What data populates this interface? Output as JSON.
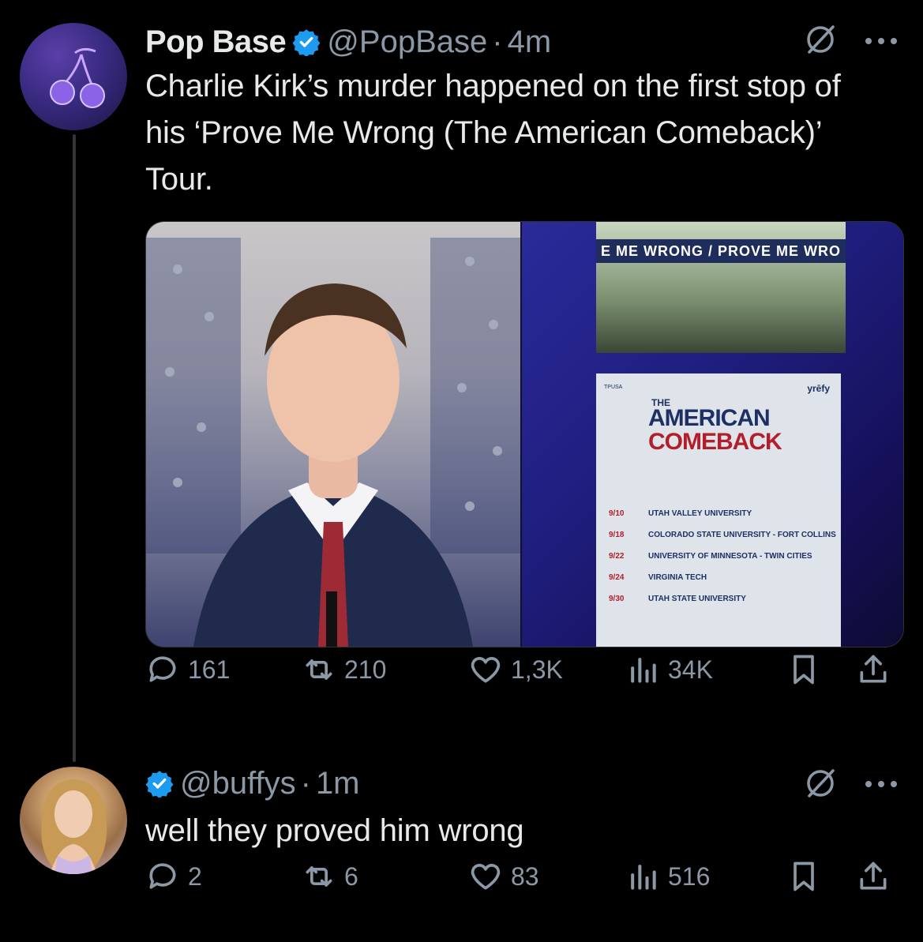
{
  "tweet1": {
    "name": "Pop Base",
    "handle": "@PopBase",
    "separator": "·",
    "time": "4m",
    "text": "Charlie Kirk’s murder happened on the first stop of his ‘Prove Me Wrong (The American Comeback)’ Tour.",
    "media": {
      "banner_text": "E ME WRONG / PROVE ME WRO",
      "flyer_brand": "yrēfy",
      "flyer_title_the": "THE",
      "flyer_title_american": "AMERICAN",
      "flyer_title_comeback": "COMEBACK",
      "schedule": [
        {
          "date": "9/10",
          "event": "UTAH VALLEY UNIVERSITY"
        },
        {
          "date": "9/18",
          "event": "COLORADO STATE UNIVERSITY - FORT COLLINS"
        },
        {
          "date": "9/22",
          "event": "UNIVERSITY OF MINNESOTA - TWIN CITIES"
        },
        {
          "date": "9/24",
          "event": "VIRGINIA TECH"
        },
        {
          "date": "9/30",
          "event": "UTAH STATE UNIVERSITY"
        }
      ]
    },
    "replies": "161",
    "reposts": "210",
    "likes": "1,3K",
    "views": "34K"
  },
  "tweet2": {
    "handle": "@buffys",
    "separator": "·",
    "time": "1m",
    "text": "well they proved him wrong",
    "replies": "2",
    "reposts": "6",
    "likes": "83",
    "views": "516"
  },
  "colors": {
    "background": "#000000",
    "text": "#e7e9ea",
    "secondary": "#8b98a5",
    "verified": "#1d9bf0"
  }
}
